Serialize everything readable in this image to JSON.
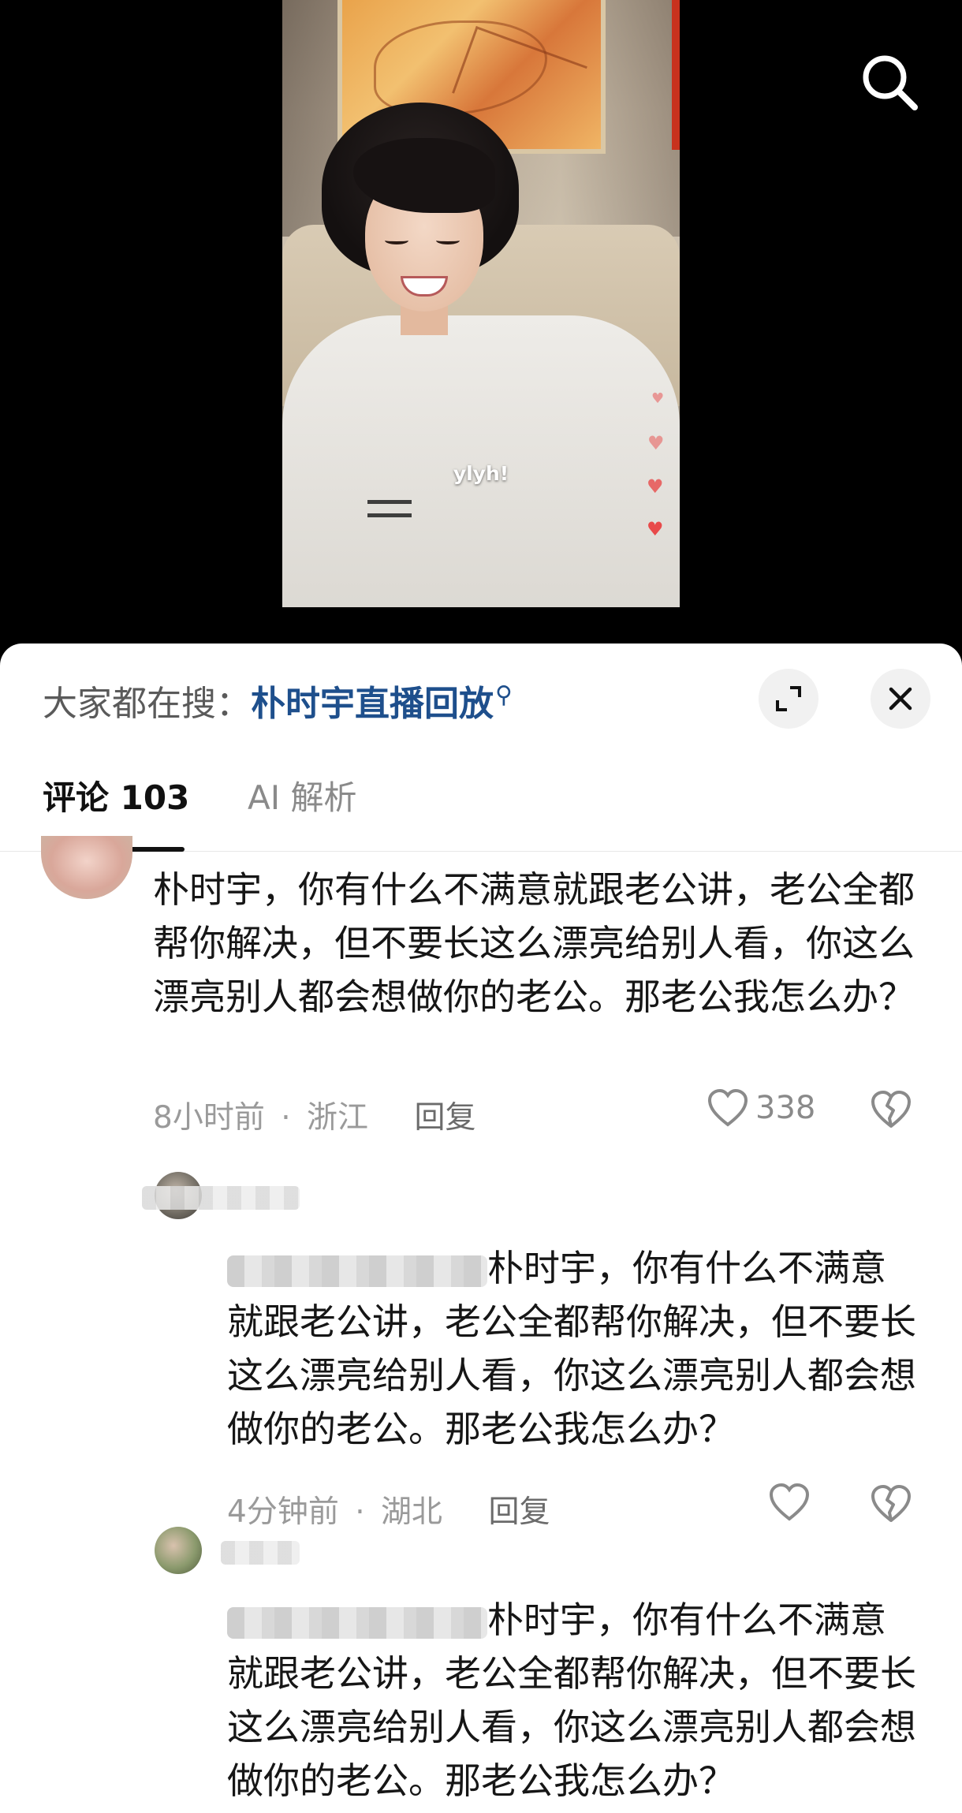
{
  "video": {
    "caption": "ylyh!"
  },
  "search_hint": {
    "prefix": "大家都在搜：",
    "term": "朴时宇直播回放"
  },
  "tabs": [
    {
      "label": "评论 103",
      "active": true
    },
    {
      "label": "AI 解析",
      "active": false
    }
  ],
  "comments": [
    {
      "text": "朴时宇，你有什么不满意就跟老公讲，老公全都帮你解决，但不要长这么漂亮给别人看，你这么漂亮别人都会想做你的老公。那老公我怎么办？",
      "time": "8小时前",
      "location": "浙江",
      "reply_label": "回复",
      "likes": "338"
    },
    {
      "text": "朴时宇，你有什么不满意就跟老公讲，老公全都帮你解决，但不要长这么漂亮给别人看，你这么漂亮别人都会想做你的老公。那老公我怎么办？",
      "time": "4分钟前",
      "location": "湖北",
      "reply_label": "回复",
      "likes": ""
    },
    {
      "text": "朴时宇，你有什么不满意就跟老公讲，老公全都帮你解决，但不要长这么漂亮给别人看，你这么漂亮别人都会想做你的老公。那老公我怎么办？"
    }
  ],
  "meta_separator": "·",
  "colors": {
    "accent_link": "#1e4f8c",
    "heart_red": "#e84a4a",
    "muted_text": "#9a9a9a"
  },
  "icons": [
    "search-icon",
    "expand-icon",
    "close-icon",
    "heart-outline-icon",
    "broken-heart-icon"
  ]
}
